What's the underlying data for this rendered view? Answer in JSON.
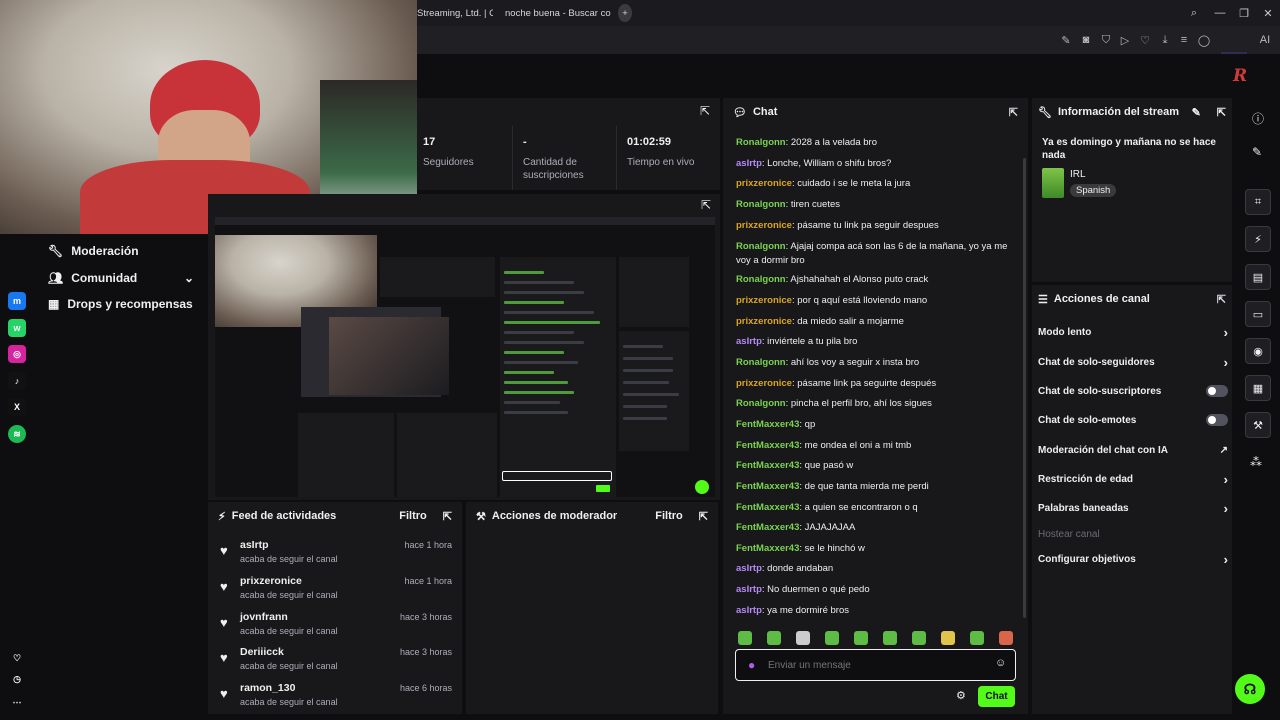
{
  "browser": {
    "tabs": [
      {
        "label": "Streaming, Ltd. | Cont"
      },
      {
        "label": "noche buena - Buscar con"
      }
    ],
    "new_tab": "+",
    "ai_label": "AI"
  },
  "stream_stats": [
    {
      "value": "17",
      "label": "Seguidores"
    },
    {
      "value": "-",
      "label": "Cantidad de suscripciones"
    },
    {
      "value": "01:02:59",
      "label": "Tiempo en vivo"
    }
  ],
  "nav": {
    "items": [
      {
        "label": "Moderación",
        "icon": "wrench-icon"
      },
      {
        "label": "Comunidad",
        "icon": "people-icon"
      },
      {
        "label": "Drops y recompensas",
        "icon": "gift-icon"
      }
    ]
  },
  "activity_feed": {
    "title": "Feed de actividades",
    "filter": "Filtro",
    "items": [
      {
        "name": "asIrtp",
        "sub": "acaba de seguir el canal",
        "time": "hace 1 hora"
      },
      {
        "name": "prixzeronice",
        "sub": "acaba de seguir el canal",
        "time": "hace 1 hora"
      },
      {
        "name": "jovnfrann",
        "sub": "acaba de seguir el canal",
        "time": "hace 3 horas"
      },
      {
        "name": "Deriiicck",
        "sub": "acaba de seguir el canal",
        "time": "hace 3 horas"
      },
      {
        "name": "ramon_130",
        "sub": "acaba de seguir el canal",
        "time": "hace 6 horas"
      }
    ]
  },
  "mod_actions": {
    "title": "Acciones de moderador",
    "filter": "Filtro"
  },
  "chat": {
    "title": "Chat",
    "messages": [
      {
        "user": "Ronalgonn",
        "color": "#7bd24f",
        "text": "2028 a la velada bro"
      },
      {
        "user": "asIrtp",
        "color": "#b689f5",
        "text": "Lonche, William o shifu bros?"
      },
      {
        "user": "prixzeronice",
        "color": "#daa520",
        "text": "cuidado i se le meta la jura"
      },
      {
        "user": "Ronalgonn",
        "color": "#7bd24f",
        "text": "tiren cuetes"
      },
      {
        "user": "prixzeronice",
        "color": "#daa520",
        "text": "pásame tu link pa seguir despues"
      },
      {
        "user": "Ronalgonn",
        "color": "#7bd24f",
        "text": "Ajajaj compa acá son las 6 de la mañana, yo ya me voy a dormir bro"
      },
      {
        "user": "Ronalgonn",
        "color": "#7bd24f",
        "text": "Ajshahahah el Alonso puto crack"
      },
      {
        "user": "prixzeronice",
        "color": "#daa520",
        "text": "por q aquí está lloviendo mano"
      },
      {
        "user": "prixzeronice",
        "color": "#daa520",
        "text": "da miedo salir a mojarme"
      },
      {
        "user": "asIrtp",
        "color": "#b689f5",
        "text": "inviértele a tu pila bro"
      },
      {
        "user": "Ronalgonn",
        "color": "#7bd24f",
        "text": "ahí los voy a seguir x insta bro"
      },
      {
        "user": "prixzeronice",
        "color": "#daa520",
        "text": "pásame link pa seguirte después"
      },
      {
        "user": "Ronalgonn",
        "color": "#7bd24f",
        "text": "pincha el perfil bro, ahí los sigues"
      },
      {
        "user": "FentMaxxer43",
        "color": "#7bd24f",
        "text": "qp"
      },
      {
        "user": "FentMaxxer43",
        "color": "#7bd24f",
        "text": "me ondea el oni a mi tmb"
      },
      {
        "user": "FentMaxxer43",
        "color": "#7bd24f",
        "text": "que pasó w"
      },
      {
        "user": "FentMaxxer43",
        "color": "#7bd24f",
        "text": "de que tanta mierda me perdi"
      },
      {
        "user": "FentMaxxer43",
        "color": "#7bd24f",
        "text": "a quien se encontraron o q"
      },
      {
        "user": "FentMaxxer43",
        "color": "#7bd24f",
        "text": "JAJAJAJAA"
      },
      {
        "user": "FentMaxxer43",
        "color": "#7bd24f",
        "text": "se le hinchó w"
      },
      {
        "user": "asIrtp",
        "color": "#b689f5",
        "text": "donde andaban"
      },
      {
        "user": "asIrtp",
        "color": "#b689f5",
        "text": "No duermen o qué pedo"
      },
      {
        "user": "asIrtp",
        "color": "#b689f5",
        "text": "ya me dormiré bros"
      }
    ],
    "input_placeholder": "Enviar un mensaje",
    "send_label": "Chat"
  },
  "stream_info": {
    "title": "Información del stream",
    "stream_title": "Ya es domingo y mañana no se hace nada",
    "category": "IRL",
    "tag": "Spanish"
  },
  "channel_actions": {
    "title": "Acciones de canal",
    "items": [
      {
        "label": "Modo lento",
        "control": "chevron"
      },
      {
        "label": "Chat de solo-seguidores",
        "control": "chevron"
      },
      {
        "label": "Chat de solo-suscriptores",
        "control": "toggle"
      },
      {
        "label": "Chat de solo-emotes",
        "control": "toggle"
      },
      {
        "label": "Moderación del chat con IA",
        "control": "external"
      },
      {
        "label": "Restricción de edad",
        "control": "chevron"
      },
      {
        "label": "Palabras baneadas",
        "control": "chevron"
      },
      {
        "label": "Hostear canal",
        "control": "none",
        "disabled": true
      },
      {
        "label": "Configurar objetivos",
        "control": "chevron"
      }
    ]
  },
  "colors": {
    "accent": "#53fc18",
    "background": "#0e0e10",
    "panel": "#18181b"
  }
}
